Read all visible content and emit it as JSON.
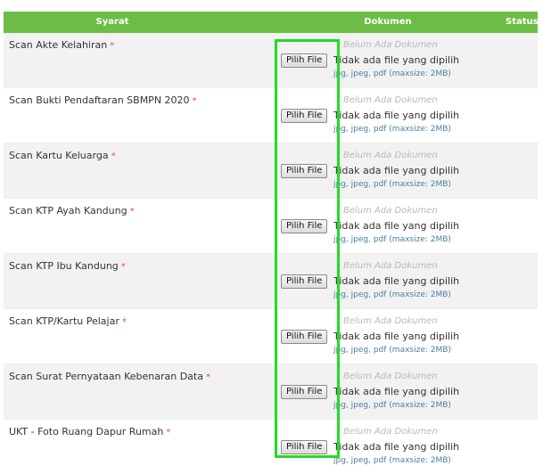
{
  "table": {
    "headers": {
      "syarat": "Syarat",
      "dokumen": "Dokumen",
      "status": "Status"
    },
    "rows": [
      {
        "label": "Scan Akte Kelahiran",
        "required_mark": "*",
        "doc_status": "Belum Ada Dokumen",
        "button_label": "Pilih File",
        "file_status": "Tidak ada file yang dipilih",
        "hint": "jpg, jpeg, pdf (maxsize: 2MB)"
      },
      {
        "label": "Scan Bukti Pendaftaran SBMPN 2020",
        "required_mark": "*",
        "doc_status": "Belum Ada Dokumen",
        "button_label": "Pilih File",
        "file_status": "Tidak ada file yang dipilih",
        "hint": "jpg, jpeg, pdf (maxsize: 2MB)"
      },
      {
        "label": "Scan Kartu Keluarga",
        "required_mark": "*",
        "doc_status": "Belum Ada Dokumen",
        "button_label": "Pilih File",
        "file_status": "Tidak ada file yang dipilih",
        "hint": "jpg, jpeg, pdf (maxsize: 2MB)"
      },
      {
        "label": "Scan KTP Ayah Kandung",
        "required_mark": "*",
        "doc_status": "Belum Ada Dokumen",
        "button_label": "Pilih File",
        "file_status": "Tidak ada file yang dipilih",
        "hint": "jpg, jpeg, pdf (maxsize: 2MB)"
      },
      {
        "label": "Scan KTP Ibu Kandung",
        "required_mark": "*",
        "doc_status": "Belum Ada Dokumen",
        "button_label": "Pilih File",
        "file_status": "Tidak ada file yang dipilih",
        "hint": "jpg, jpeg, pdf (maxsize: 2MB)"
      },
      {
        "label": "Scan KTP/Kartu Pelajar",
        "required_mark": "*",
        "doc_status": "Belum Ada Dokumen",
        "button_label": "Pilih File",
        "file_status": "Tidak ada file yang dipilih",
        "hint": "jpg, jpeg, pdf (maxsize: 2MB)"
      },
      {
        "label": "Scan Surat Pernyataan Kebenaran Data",
        "required_mark": "*",
        "doc_status": "Belum Ada Dokumen",
        "button_label": "Pilih File",
        "file_status": "Tidak ada file yang dipilih",
        "hint": "jpg, jpeg, pdf (maxsize: 2MB)"
      },
      {
        "label": "UKT - Foto Ruang Dapur Rumah",
        "required_mark": "*",
        "doc_status": "Belum Ada Dokumen",
        "button_label": "Pilih File",
        "file_status": "Tidak ada file yang dipilih",
        "hint": "jpg, jpeg, pdf (maxsize: 2MB)"
      }
    ]
  },
  "colors": {
    "header_bg": "#6cbd45",
    "highlight": "#22dd22",
    "required": "#e74c3c",
    "hint": "#4a7ea3"
  }
}
